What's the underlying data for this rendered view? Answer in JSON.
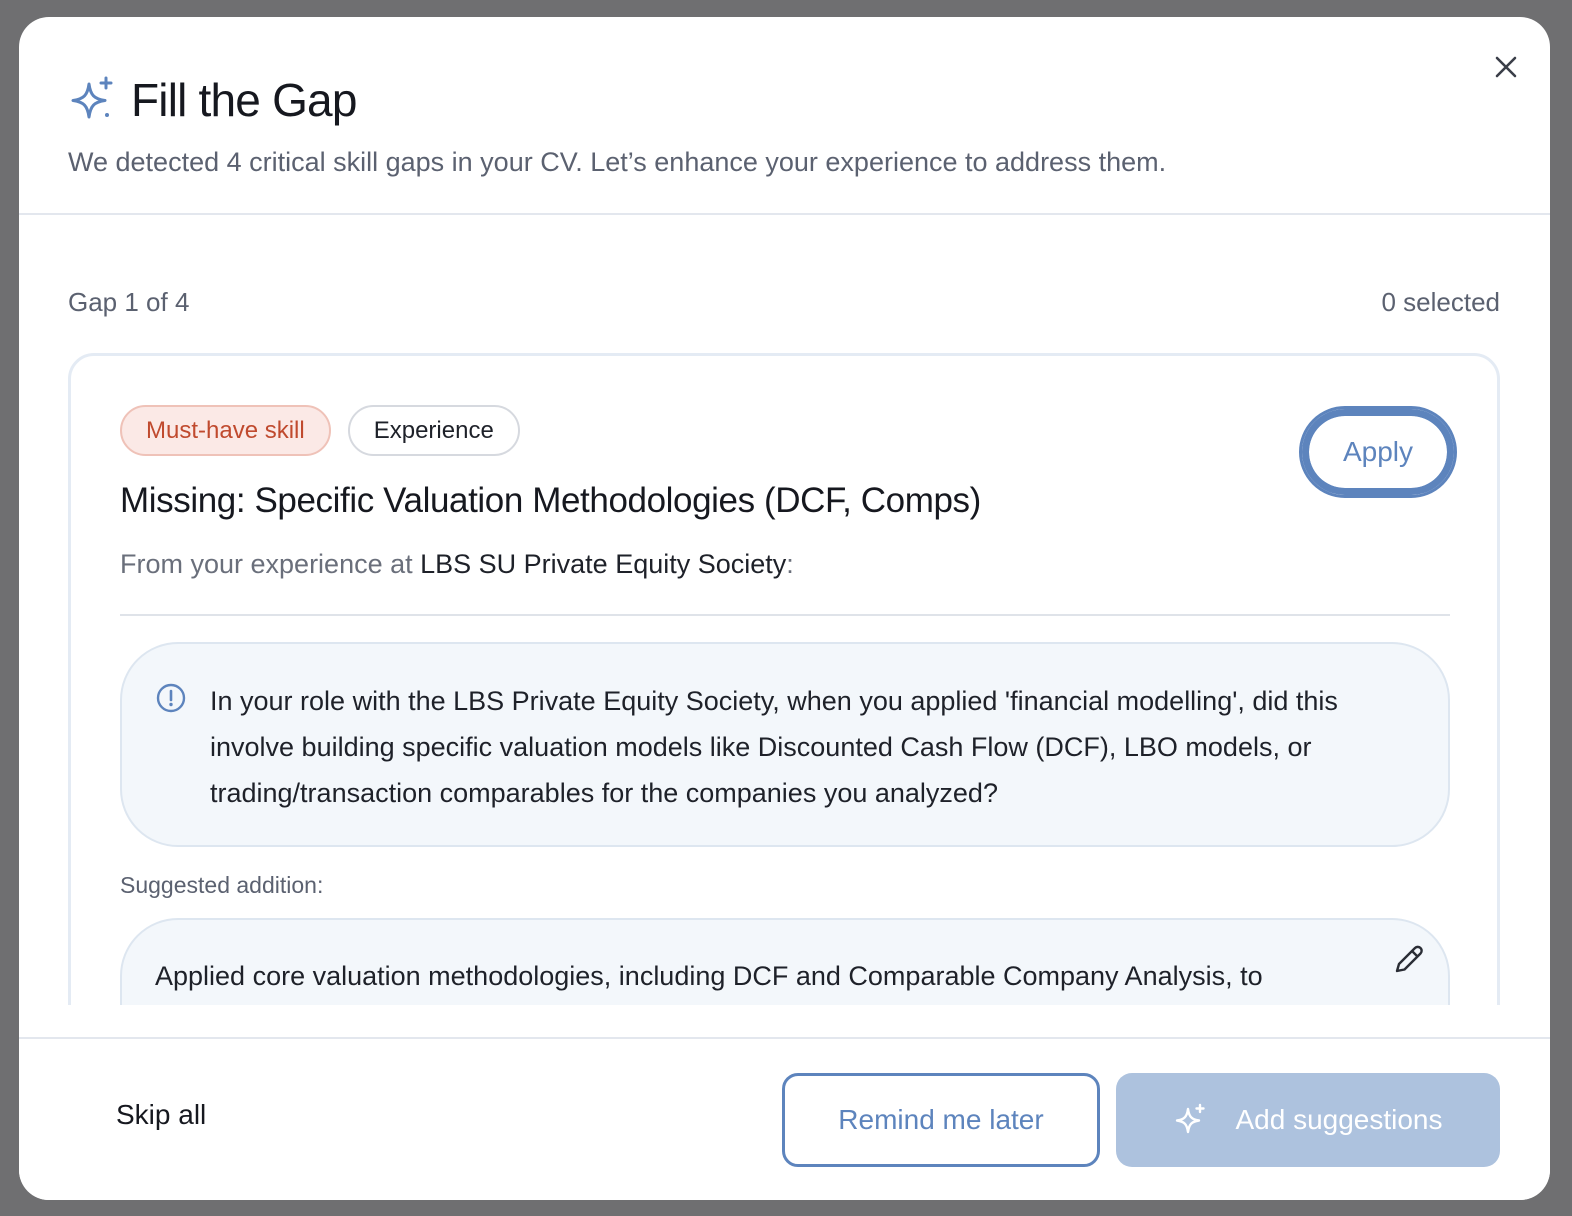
{
  "modal": {
    "title": "Fill the Gap",
    "subtitle": "We detected 4 critical skill gaps in your CV. Let’s enhance your experience to address them.",
    "close_icon": "close-icon",
    "title_icon": "sparkles-icon"
  },
  "progress": {
    "gap_label": "Gap 1 of 4",
    "selected_label": "0 selected"
  },
  "gap_card": {
    "tags": [
      "Must-have skill",
      "Experience"
    ],
    "apply_label": "Apply",
    "missing_title": "Missing: Specific Valuation Methodologies (DCF, Comps)",
    "from_prefix": "From your experience at ",
    "from_org": "LBS SU Private Equity Society",
    "from_suffix": ":",
    "question_icon": "info-icon",
    "question": "In your role with the LBS Private Equity Society, when you applied 'financial modelling', did this involve building specific valuation models like Discounted Cash Flow (DCF), LBO models, or trading/transaction comparables for the companies you analyzed?",
    "suggested_label": "Suggested addition:",
    "suggested_text": "Applied core valuation methodologies, including DCF and Comparable Company Analysis, to",
    "edit_icon": "pencil-icon"
  },
  "footer": {
    "skip_label": "Skip all",
    "remind_label": "Remind me later",
    "add_label": "Add suggestions",
    "add_icon": "sparkles-icon"
  },
  "colors": {
    "accent": "#5d84bd",
    "must_have_bg": "#fbe9e6",
    "must_have_text": "#c04a2e",
    "disabled_button": "#adc2de"
  }
}
